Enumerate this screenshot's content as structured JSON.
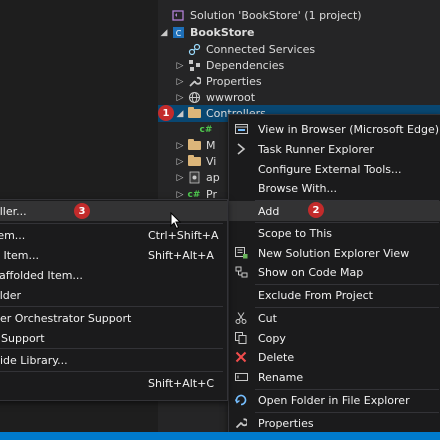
{
  "solution_explorer": {
    "items": [
      {
        "label": "Solution 'BookStore' (1 project)",
        "arrow": "",
        "icon": "solution-icon"
      },
      {
        "label": "BookStore",
        "arrow": "◢",
        "icon": "csharp-project-icon"
      },
      {
        "label": "Connected Services",
        "arrow": "",
        "icon": "connected-services-icon"
      },
      {
        "label": "Dependencies",
        "arrow": "▷",
        "icon": "dependencies-icon"
      },
      {
        "label": "Properties",
        "arrow": "▷",
        "icon": "wrench-icon"
      },
      {
        "label": "wwwroot",
        "arrow": "▷",
        "icon": "globe-icon"
      },
      {
        "label": "Controllers",
        "arrow": "◢",
        "icon": "folder-icon"
      },
      {
        "label": "",
        "arrow": "",
        "icon": "csharp-file-icon"
      },
      {
        "label": "M",
        "arrow": "▷",
        "icon": "folder-icon"
      },
      {
        "label": "Vi",
        "arrow": "▷",
        "icon": "folder-icon"
      },
      {
        "label": "ap",
        "arrow": "▷",
        "icon": "settings-file-icon"
      },
      {
        "label": "Pr",
        "arrow": "▷",
        "icon": "csharp-file-icon"
      }
    ]
  },
  "context_menu": {
    "items": [
      {
        "label": "View in Browser (Microsoft Edge)",
        "icon": "browser-icon"
      },
      {
        "label": "Task Runner Explorer",
        "icon": "task-runner-icon"
      },
      {
        "label": "Configure External Tools...",
        "icon": ""
      },
      {
        "label": "Browse With...",
        "icon": ""
      },
      {
        "label": "Add",
        "icon": ""
      },
      {
        "label": "Scope to This",
        "icon": ""
      },
      {
        "label": "New Solution Explorer View",
        "icon": "new-view-icon"
      },
      {
        "label": "Show on Code Map",
        "icon": "code-map-icon"
      },
      {
        "label": "Exclude From Project",
        "icon": ""
      },
      {
        "label": "Cut",
        "icon": "scissors-icon"
      },
      {
        "label": "Copy",
        "icon": "copy-icon"
      },
      {
        "label": "Delete",
        "icon": "delete-x-icon"
      },
      {
        "label": "Rename",
        "icon": "rename-icon"
      },
      {
        "label": "Open Folder in File Explorer",
        "icon": "refresh-arrow-icon"
      },
      {
        "label": "Properties",
        "icon": "wrench-icon"
      }
    ]
  },
  "add_submenu": {
    "items": [
      {
        "label": "oller...",
        "shortcut": ""
      },
      {
        "label": "tem...",
        "shortcut": "Ctrl+Shift+A"
      },
      {
        "label": "g Item...",
        "shortcut": "Shift+Alt+A"
      },
      {
        "label": "caffolded Item...",
        "shortcut": ""
      },
      {
        "label": "older",
        "shortcut": ""
      },
      {
        "label": "ner Orchestrator Support",
        "shortcut": ""
      },
      {
        "label": "r Support",
        "shortcut": ""
      },
      {
        "label": "Side Library...",
        "shortcut": ""
      },
      {
        "label": "",
        "shortcut": "Shift+Alt+C"
      }
    ]
  },
  "badges": {
    "one": "1",
    "two": "2",
    "three": "3"
  },
  "colors": {
    "selection": "#094771",
    "menu_bg": "#1b1b1c",
    "menu_hover": "#333334",
    "badge": "#c32b2b",
    "status_bar": "#007acc"
  }
}
